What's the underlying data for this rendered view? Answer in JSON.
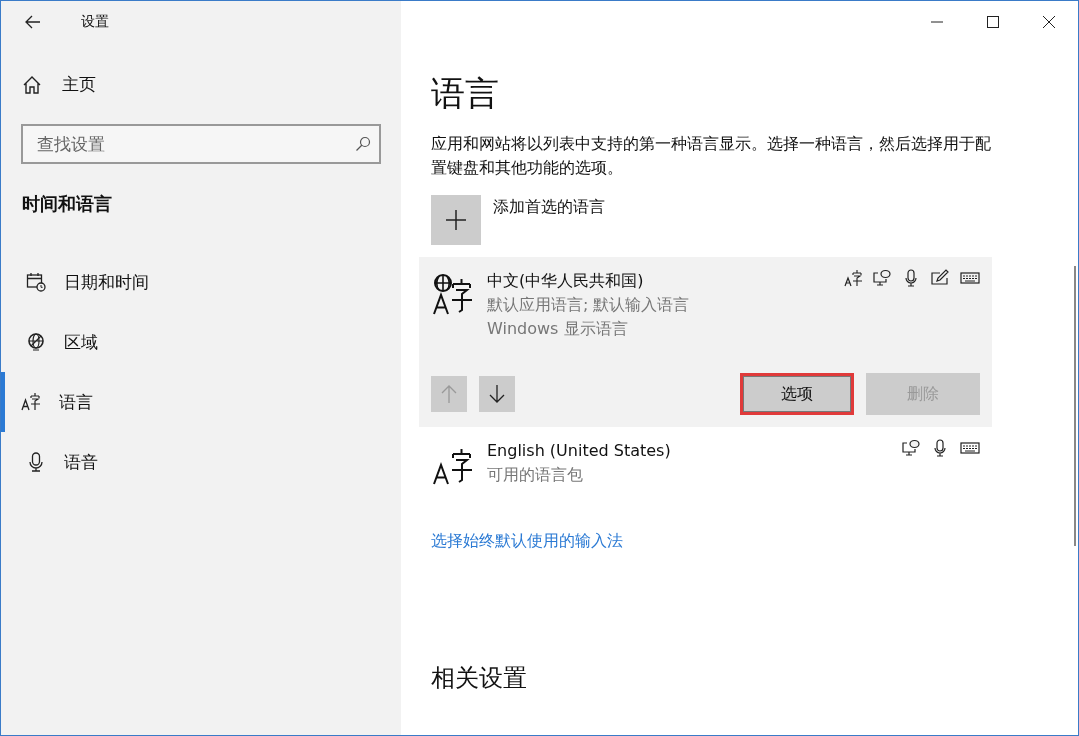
{
  "window": {
    "title": "设置"
  },
  "sidebar": {
    "home": "主页",
    "search": {
      "placeholder": "查找设置"
    },
    "section": "时间和语言",
    "items": [
      {
        "label": "日期和时间",
        "selected": false
      },
      {
        "label": "区域",
        "selected": false
      },
      {
        "label": "语言",
        "selected": true
      },
      {
        "label": "语音",
        "selected": false
      }
    ]
  },
  "page": {
    "title": "语言",
    "description": "应用和网站将以列表中支持的第一种语言显示。选择一种语言，然后选择用于配置键盘和其他功能的选项。",
    "add_button": "添加首选的语言",
    "languages": [
      {
        "name": "中文(中华人民共和国)",
        "details": [
          "默认应用语言; 默认输入语言",
          "Windows 显示语言"
        ],
        "selected": true,
        "globe_badge": true,
        "features": [
          {
            "kind": "display"
          },
          {
            "kind": "speech"
          },
          {
            "kind": "microphone"
          },
          {
            "kind": "handwriting"
          },
          {
            "kind": "keyboard"
          }
        ],
        "move_up": {
          "disabled": true
        },
        "move_down": {
          "disabled": false
        },
        "options_button": {
          "label": "选项",
          "highlighted": true
        },
        "remove_button": {
          "label": "删除",
          "disabled": true
        }
      },
      {
        "name": "English (United States)",
        "details": [
          "可用的语言包"
        ],
        "selected": false,
        "globe_badge": false,
        "features": [
          {
            "kind": "speech"
          },
          {
            "kind": "microphone"
          },
          {
            "kind": "keyboard"
          }
        ]
      }
    ],
    "link": "选择始终默认使用的输入法",
    "related_title": "相关设置"
  }
}
